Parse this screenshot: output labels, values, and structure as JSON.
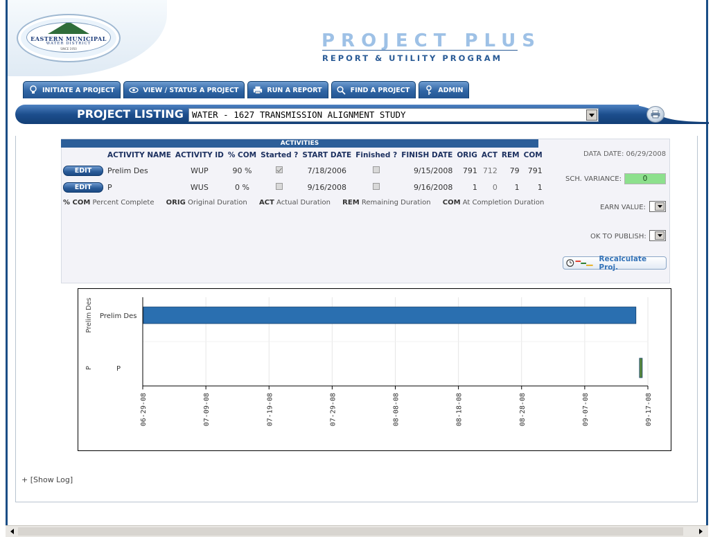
{
  "brand": {
    "org_line1": "EASTERN MUNICIPAL",
    "org_line2": "WATER DISTRICT",
    "org_line3": "SINCE 1950",
    "app_title": "PROJECT PLUS",
    "app_subtitle": "REPORT & UTILITY PROGRAM"
  },
  "tabs": [
    {
      "label": "INITIATE A PROJECT",
      "icon": "lightbulb-icon"
    },
    {
      "label": "VIEW / STATUS A PROJECT",
      "icon": "eye-icon"
    },
    {
      "label": "RUN A REPORT",
      "icon": "printer-icon"
    },
    {
      "label": "FIND A PROJECT",
      "icon": "magnifier-icon"
    },
    {
      "label": "ADMIN",
      "icon": "key-icon"
    }
  ],
  "listing": {
    "label": "PROJECT LISTING",
    "selected_project": "WATER - 1627 TRANSMISSION ALIGNMENT STUDY",
    "print_icon": "printer-icon"
  },
  "activities": {
    "title": "ACTIVITIES",
    "columns": [
      "ACTIVITY NAME",
      "ACTIVITY ID",
      "% COM",
      "Started ?",
      "START DATE",
      "Finished ?",
      "FINISH DATE",
      "ORIG",
      "ACT",
      "REM",
      "COM"
    ],
    "edit_label": "EDIT",
    "rows": [
      {
        "name": "Prelim Des",
        "id": "WUP",
        "pct": "90 %",
        "started": true,
        "start": "7/18/2006",
        "finished": false,
        "finish": "9/15/2008",
        "orig": "791",
        "act": "712",
        "rem": "79",
        "com": "791"
      },
      {
        "name": "P",
        "id": "WUS",
        "pct": "0 %",
        "started": false,
        "start": "9/16/2008",
        "finished": false,
        "finish": "9/16/2008",
        "orig": "1",
        "act": "0",
        "rem": "1",
        "com": "1"
      }
    ],
    "legend": [
      {
        "abbr": "% COM",
        "text": "Percent Complete"
      },
      {
        "abbr": "ORIG",
        "text": "Original Duration"
      },
      {
        "abbr": "ACT",
        "text": "Actual Duration"
      },
      {
        "abbr": "REM",
        "text": "Remaining Duration"
      },
      {
        "abbr": "COM",
        "text": "At Completion Duration"
      }
    ]
  },
  "side": {
    "data_date": "DATA DATE: 06/29/2008",
    "sch_variance_label": "SCH. VARIANCE:",
    "sch_variance_value": "0",
    "earn_value_label": "EARN VALUE:",
    "ok_publish_label": "OK TO PUBLISH:",
    "recalc_label": "Recalculate Proj."
  },
  "chart_data": {
    "type": "bar",
    "orientation": "horizontal-gantt",
    "categories": [
      "Prelim Des",
      "P"
    ],
    "group_labels": [
      "Prelim Des",
      "P"
    ],
    "bars": [
      {
        "category": "Prelim Des",
        "start": "2008-06-29",
        "end": "2008-09-15",
        "color": "#2a6fb0"
      },
      {
        "category": "P",
        "start": "2008-09-16",
        "end": "2008-09-16",
        "color": "#5a8a3a"
      }
    ],
    "x_ticks": [
      "06-29-08",
      "07-09-08",
      "07-19-08",
      "07-29-08",
      "08-08-08",
      "08-18-08",
      "08-28-08",
      "09-07-08",
      "09-17-08"
    ],
    "x_range": [
      "2008-06-29",
      "2008-09-17"
    ],
    "grid": true
  },
  "show_log": "+ [Show Log]"
}
